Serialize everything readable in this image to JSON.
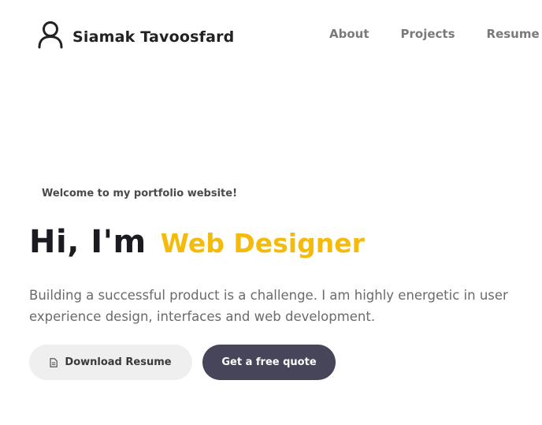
{
  "header": {
    "brand_name": "Siamak Tavoosfard",
    "brand_icon": "user-icon",
    "nav": [
      {
        "label": "About"
      },
      {
        "label": "Projects"
      },
      {
        "label": "Resume"
      }
    ]
  },
  "hero": {
    "welcome": "Welcome to my portfolio website!",
    "greeting": "Hi, I'm",
    "role": "Web Designer",
    "description": "Building a successful product is a challenge. I am highly energetic in user experience design, interfaces and web development."
  },
  "buttons": {
    "download_resume": "Download Resume",
    "download_icon": "document-icon",
    "free_quote": "Get a free quote"
  },
  "colors": {
    "accent": "#f5bb0c",
    "dark_button": "#47455a",
    "light_button": "#efefef"
  }
}
